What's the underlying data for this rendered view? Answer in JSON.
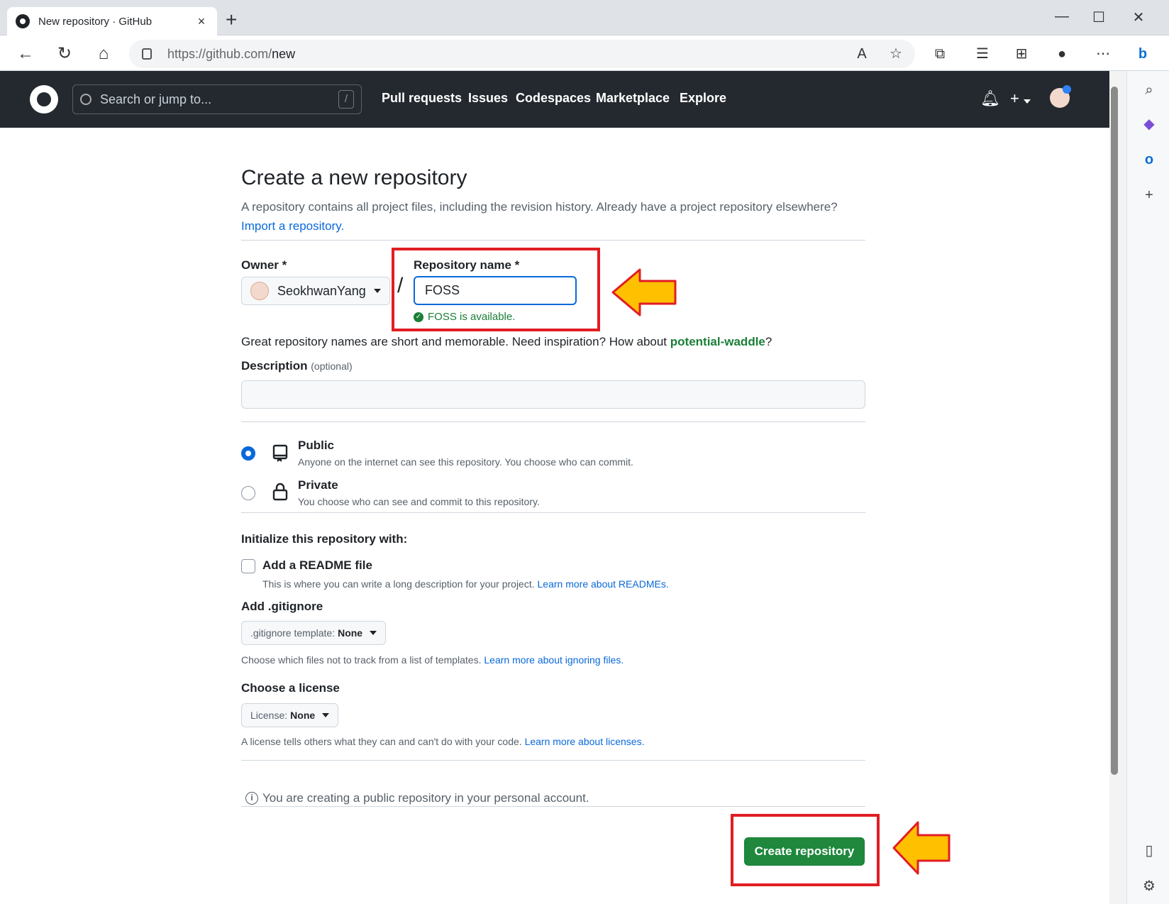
{
  "browser": {
    "tab_title": "New repository · GitHub",
    "tab_close": "×",
    "new_tab": "+",
    "url_host": "https://github.com/",
    "url_path": "new",
    "win_min": "—",
    "win_max": "☐",
    "win_close": "✕"
  },
  "header": {
    "search_placeholder": "Search or jump to...",
    "search_shortcut": "/",
    "nav": [
      "Pull requests",
      "Issues",
      "Codespaces",
      "Marketplace",
      "Explore"
    ],
    "plus": "+"
  },
  "page": {
    "title": "Create a new repository",
    "lead": "A repository contains all project files, including the revision history. Already have a project repository elsewhere?",
    "import_link": "Import a repository.",
    "owner_label": "Owner *",
    "owner_value": "SeokhwanYang",
    "separator": "/",
    "repo_label": "Repository name *",
    "repo_value": "FOSS",
    "available": "FOSS is available.",
    "tip_prefix": "Great repository names are short and memorable. Need inspiration? How about ",
    "tip_suggestion": "potential-waddle",
    "tip_suffix": "?",
    "desc_label": "Description",
    "desc_optional": "(optional)",
    "public_title": "Public",
    "public_desc": "Anyone on the internet can see this repository. You choose who can commit.",
    "private_title": "Private",
    "private_desc": "You choose who can see and commit to this repository.",
    "init_label": "Initialize this repository with:",
    "readme_title": "Add a README file",
    "readme_desc": "This is where you can write a long description for your project. ",
    "readme_link": "Learn more about READMEs.",
    "gitignore_label": "Add .gitignore",
    "gitignore_select_label": ".gitignore template:",
    "gitignore_select_value": "None",
    "gitignore_desc": "Choose which files not to track from a list of templates. ",
    "gitignore_link": "Learn more about ignoring files.",
    "license_label": "Choose a license",
    "license_select_label": "License:",
    "license_select_value": "None",
    "license_desc": "A license tells others what they can and can't do with your code. ",
    "license_link": "Learn more about licenses.",
    "info_icon": "i",
    "note": "You are creating a public repository in your personal account.",
    "create_button": "Create repository"
  },
  "colors": {
    "header_bg": "#24292f",
    "link": "#0969da",
    "success": "#1a7f37",
    "primary_button": "#1f883d",
    "annotation_red": "#e11d24",
    "annotation_arrow": "#ffc000"
  }
}
